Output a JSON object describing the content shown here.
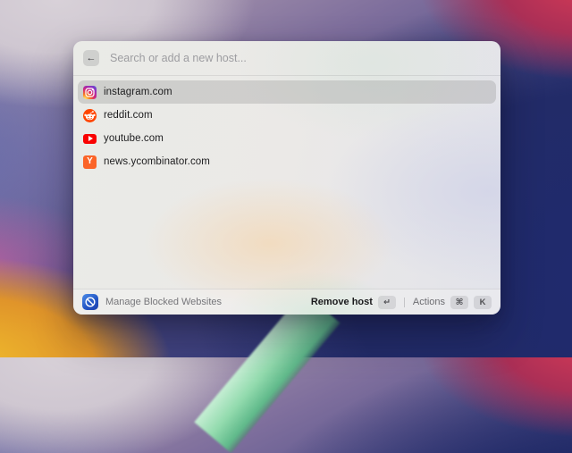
{
  "window": {
    "search": {
      "placeholder": "Search or add a new host...",
      "back_icon": "←"
    },
    "hosts": [
      {
        "label": "instagram.com",
        "icon": "instagram-icon",
        "selected": true
      },
      {
        "label": "reddit.com",
        "icon": "reddit-icon",
        "selected": false
      },
      {
        "label": "youtube.com",
        "icon": "youtube-icon",
        "selected": false
      },
      {
        "label": "news.ycombinator.com",
        "icon": "ycombinator-icon",
        "selected": false
      }
    ],
    "footer": {
      "app_label": "Manage Blocked Websites",
      "remove_host_label": "Remove host",
      "remove_host_key": "↵",
      "actions_label": "Actions",
      "actions_keys": [
        "⌘",
        "K"
      ]
    }
  },
  "glyphs": {
    "ycombinator": "Y"
  },
  "colors": {
    "selection_gray": "#d5d6d4",
    "youtube_red": "#f90202",
    "reddit_orange": "#ff4500",
    "ycombinator_orange": "#fb6428",
    "app_icon_blue": "#2457c5",
    "wallpaper_navy": "#222b68",
    "wallpaper_yellow": "#efbc2c",
    "wallpaper_crimson": "#c93355",
    "wallpaper_slate_blue": "#666cab",
    "wallpaper_mint": "#93dbae"
  }
}
